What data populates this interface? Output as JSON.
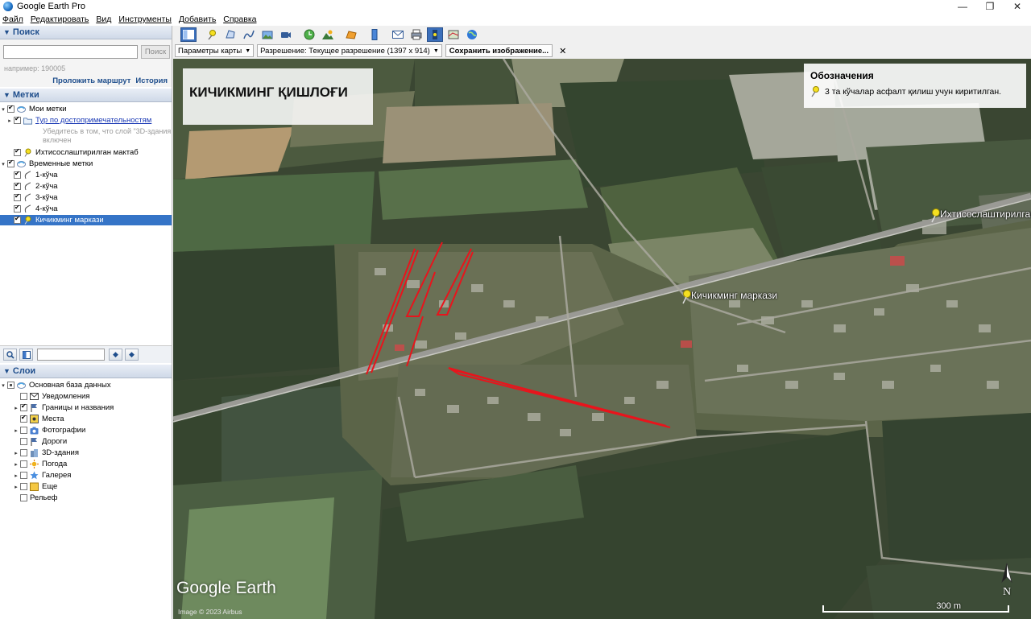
{
  "window": {
    "title": "Google Earth Pro",
    "controls": {
      "minimize": "—",
      "maximize": "❐",
      "close": "✕"
    }
  },
  "menu": [
    "Файл",
    "Редактировать",
    "Вид",
    "Инструменты",
    "Добавить",
    "Справка"
  ],
  "search": {
    "header": "Поиск",
    "input_value": "",
    "button_label": "Поиск",
    "hint": "например: 190005",
    "link_route": "Проложить маршрут",
    "link_history": "История"
  },
  "places": {
    "header": "Метки",
    "my_places": "Мои метки",
    "tour": "Тур по достопримечательностям",
    "tour_hint_1": "Убедитесь в том, что слой \"3D-здания",
    "tour_hint_2": "включен",
    "school": "Ихтисослаштирилган мактаб",
    "temporary": "Временные метки",
    "streets": [
      "1-кўча",
      "2-кўча",
      "3-кўча",
      "4-кўча"
    ],
    "center": "Кичикминг маркази"
  },
  "layers": {
    "header": "Слои",
    "primary": "Основная база данных",
    "items": [
      "Уведомления",
      "Границы и названия",
      "Места",
      "Фотографии",
      "Дороги",
      "3D-здания",
      "Погода",
      "Галерея",
      "Еще",
      "Рельеф"
    ]
  },
  "printbar": {
    "map_options": "Параметры карты",
    "resolution": "Разрешение: Текущее разрешение (1397 x 914)",
    "save_image": "Сохранить изображение...",
    "close": "✕"
  },
  "map": {
    "title": "КИЧИКМИНГ ҚИШЛОҒИ",
    "legend_title": "Обозначения",
    "legend_item": "3 та кўчалар асфалт қилиш учун киритилган.",
    "pin_center": "Кичикминг маркази",
    "pin_school": "Ихтисослаштирилган",
    "watermark": "Google Earth",
    "copyright": "Image © 2023 Airbus",
    "scale": "300 m",
    "north": "N"
  },
  "colors": {
    "accent": "#3574c7",
    "header_text": "#1f4e8c",
    "route": "#e8141c",
    "pin": "#f5e021"
  },
  "icons": {
    "toolbar": [
      "sidebar-toggle-icon",
      "placemark-icon",
      "polygon-icon",
      "path-icon",
      "image-overlay-icon",
      "record-tour-icon",
      "historical-imagery-icon",
      "sun-icon",
      "planets-icon",
      "ruler-icon",
      "email-icon",
      "print-icon",
      "save-image-icon",
      "view-in-maps-icon",
      "earth-icon"
    ]
  }
}
